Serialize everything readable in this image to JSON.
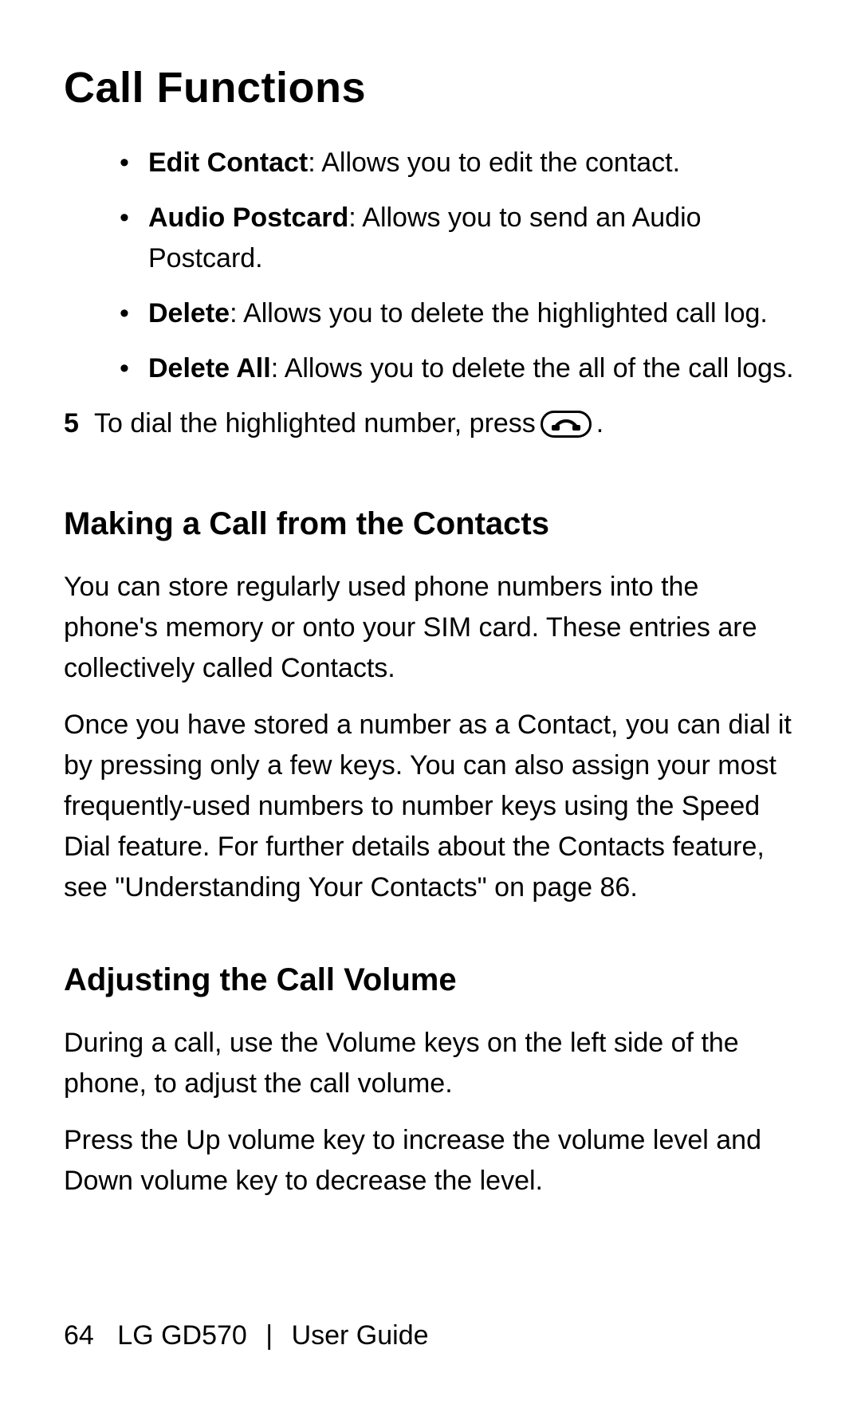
{
  "title": "Call Functions",
  "bullets": [
    {
      "term": "Edit Contact",
      "desc": ": Allows you to edit the contact."
    },
    {
      "term": "Audio Postcard",
      "desc": ": Allows you to send an Audio Postcard."
    },
    {
      "term": "Delete",
      "desc": ": Allows you to delete the highlighted call log."
    },
    {
      "term": "Delete All",
      "desc": ": Allows you to delete the all of the call logs."
    }
  ],
  "step": {
    "num": "5",
    "before": "To dial the highlighted number, press ",
    "after": "."
  },
  "section1": {
    "heading": "Making a Call from the Contacts",
    "p1": "You can store regularly used phone numbers into the phone's memory or onto your SIM card. These entries are collectively called Contacts.",
    "p2a": "Once you have stored a number as a Contact, you can dial it by pressing only a few keys. You can also assign your most frequently-used numbers to number keys using the Speed Dial feature. For further details about the Contacts feature, see \"",
    "p2_link": "Understanding Your Contacts",
    "p2b": "\" on page 86."
  },
  "section2": {
    "heading": "Adjusting the Call Volume",
    "p1": "During a call, use the Volume keys on the left side of the phone, to adjust the call volume.",
    "p2": "Press the Up volume key to increase the volume level and Down volume key to decrease the level."
  },
  "footer": {
    "page": "64",
    "model": "LG GD570",
    "sep": "|",
    "guide": "User Guide"
  }
}
